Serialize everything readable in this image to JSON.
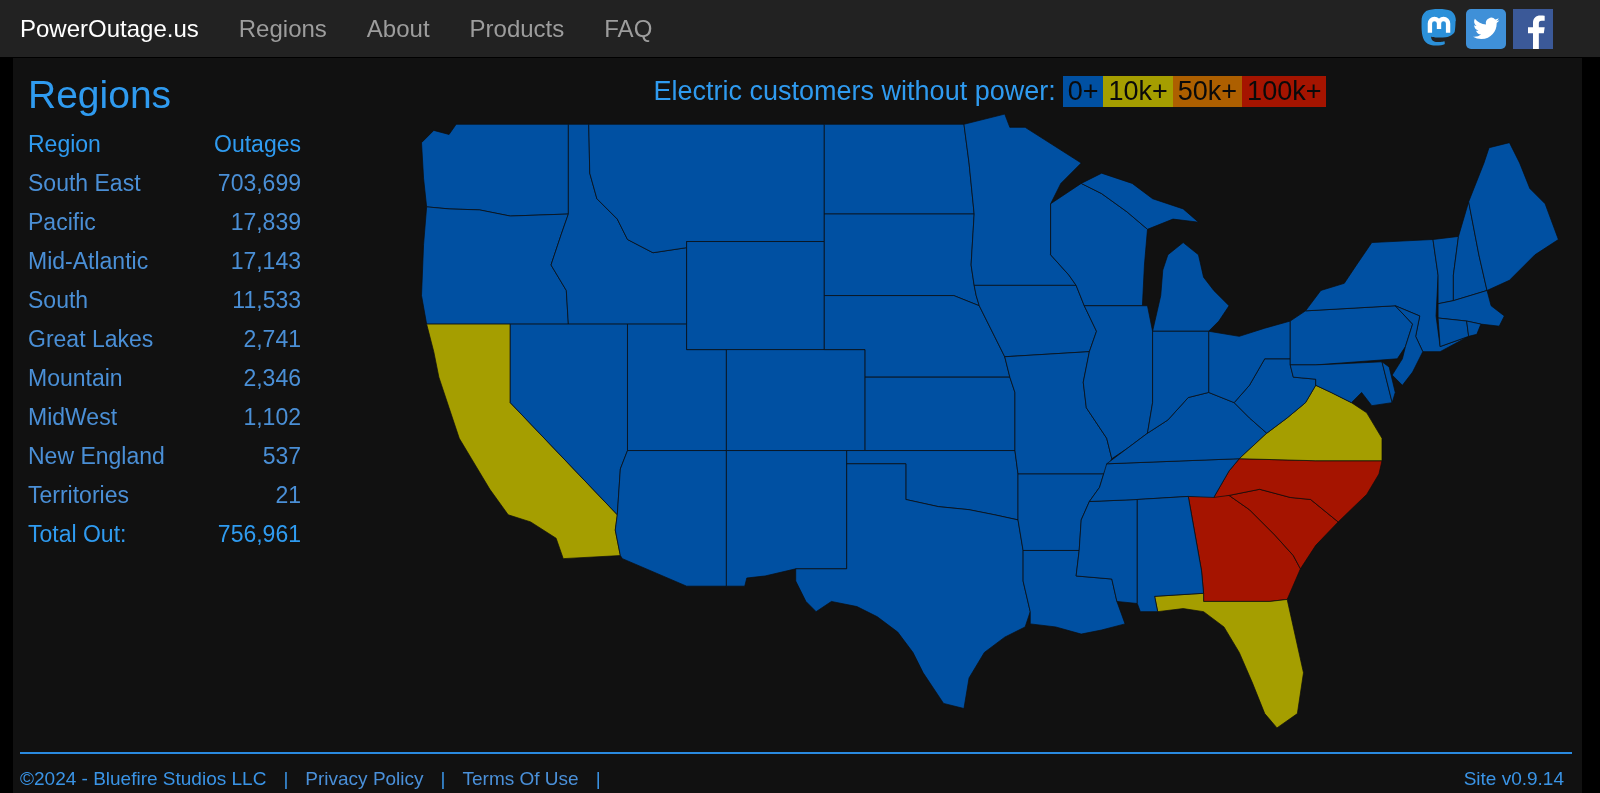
{
  "navbar": {
    "brand": "PowerOutage.us",
    "links": [
      "Regions",
      "About",
      "Products",
      "FAQ"
    ]
  },
  "regions_panel": {
    "title": "Regions",
    "columns": [
      "Region",
      "Outages"
    ],
    "rows": [
      {
        "region": "South East",
        "outages": "703,699"
      },
      {
        "region": "Pacific",
        "outages": "17,839"
      },
      {
        "region": "Mid-Atlantic",
        "outages": "17,143"
      },
      {
        "region": "South",
        "outages": "11,533"
      },
      {
        "region": "Great Lakes",
        "outages": "2,741"
      },
      {
        "region": "Mountain",
        "outages": "2,346"
      },
      {
        "region": "MidWest",
        "outages": "1,102"
      },
      {
        "region": "New England",
        "outages": "537"
      },
      {
        "region": "Territories",
        "outages": "21"
      }
    ],
    "total": {
      "label": "Total Out:",
      "value": "756,961"
    }
  },
  "map": {
    "legend": {
      "label": "Electric customers without power:",
      "items": [
        {
          "label": "0+",
          "color": "#0050a2"
        },
        {
          "label": "10k+",
          "color": "#a59e00"
        },
        {
          "label": "50k+",
          "color": "#ad5f00"
        },
        {
          "label": "100k+",
          "color": "#a51400"
        }
      ]
    },
    "states": [
      {
        "color": "#0050a2"
      },
      {
        "color": "#0050a2"
      },
      {
        "color": "#a59e00"
      },
      {
        "color": "#0050a2"
      },
      {
        "color": "#0050a2"
      },
      {
        "color": "#0050a2"
      },
      {
        "color": "#0050a2"
      },
      {
        "color": "#0050a2"
      },
      {
        "color": "#0050a2"
      },
      {
        "color": "#0050a2"
      },
      {
        "color": "#0050a2"
      },
      {
        "color": "#0050a2"
      },
      {
        "color": "#0050a2"
      },
      {
        "color": "#0050a2"
      },
      {
        "color": "#0050a2"
      },
      {
        "color": "#0050a2"
      },
      {
        "color": "#0050a2"
      },
      {
        "color": "#0050a2"
      },
      {
        "color": "#0050a2"
      },
      {
        "color": "#0050a2"
      },
      {
        "color": "#0050a2"
      },
      {
        "color": "#0050a2"
      },
      {
        "color": "#0050a2"
      },
      {
        "color": "#0050a2"
      },
      {
        "color": "#0050a2"
      },
      {
        "color": "#0050a2"
      },
      {
        "color": "#a51400"
      },
      {
        "color": "#a59e00"
      },
      {
        "color": "#a51400"
      },
      {
        "color": "#a51400"
      },
      {
        "color": "#0050a2"
      },
      {
        "color": "#0050a2"
      },
      {
        "color": "#a59e00"
      },
      {
        "color": "#0050a2"
      },
      {
        "color": "#0050a2"
      },
      {
        "color": "#0050a2"
      },
      {
        "color": "#0050a2"
      },
      {
        "color": "#0050a2"
      },
      {
        "color": "#0050a2"
      },
      {
        "color": "#0050a2"
      },
      {
        "color": "#0050a2"
      },
      {
        "color": "#0050a2"
      },
      {
        "color": "#0050a2"
      },
      {
        "color": "#0050a2"
      },
      {
        "color": "#0050a2"
      },
      {
        "color": "#0050a2"
      },
      {
        "color": "#0050a2"
      },
      {
        "color": "#0050a2"
      }
    ]
  },
  "footer": {
    "items": [
      {
        "kind": "text",
        "text": "©2024 - Bluefire Studios LLC"
      },
      {
        "kind": "separator",
        "text": "|"
      },
      {
        "kind": "link",
        "text": "Privacy Policy"
      },
      {
        "kind": "separator",
        "text": "|"
      },
      {
        "kind": "link",
        "text": "Terms Of Use"
      },
      {
        "kind": "separator",
        "text": "|"
      }
    ],
    "version": "Site v0.9.14"
  }
}
